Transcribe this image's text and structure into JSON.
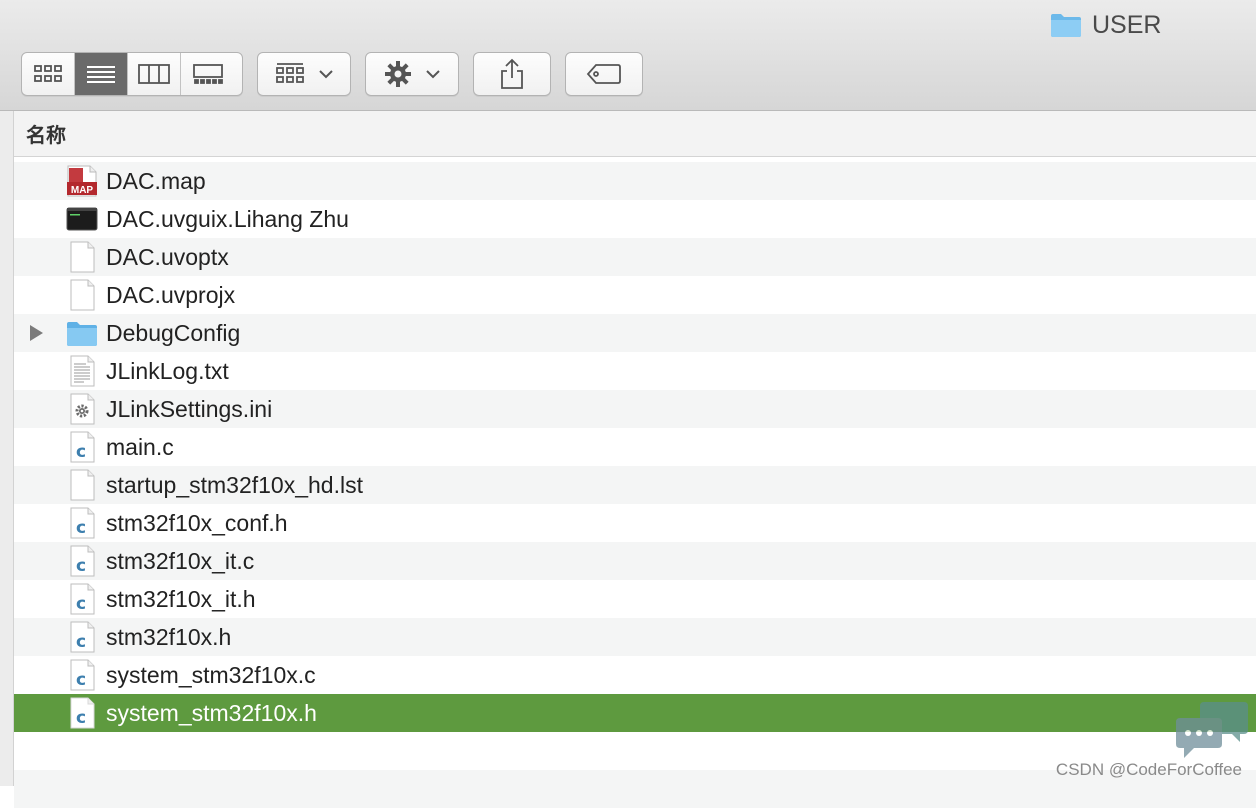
{
  "window": {
    "title": "USER",
    "folder_icon": "folder-icon"
  },
  "toolbar": {
    "view_modes": [
      {
        "name": "icon-view",
        "icon": "grid-icon",
        "active": false
      },
      {
        "name": "list-view",
        "icon": "list-icon",
        "active": true
      },
      {
        "name": "column-view",
        "icon": "columns-icon",
        "active": false
      },
      {
        "name": "gallery-view",
        "icon": "gallery-icon",
        "active": false
      }
    ],
    "group_icon": "group-grid-icon",
    "action_icon": "gear-icon",
    "share_icon": "share-icon",
    "tag_icon": "tag-icon"
  },
  "list": {
    "column_header": "名称",
    "files": [
      {
        "name": "DAC.map",
        "icon": "map-file-icon"
      },
      {
        "name": "DAC.uvguix.Lihang Zhu",
        "icon": "terminal-file-icon"
      },
      {
        "name": "DAC.uvoptx",
        "icon": "blank-file-icon"
      },
      {
        "name": "DAC.uvprojx",
        "icon": "blank-file-icon"
      },
      {
        "name": "DebugConfig",
        "icon": "folder-icon",
        "folder": true
      },
      {
        "name": "JLinkLog.txt",
        "icon": "text-file-icon"
      },
      {
        "name": "JLinkSettings.ini",
        "icon": "settings-file-icon"
      },
      {
        "name": "main.c",
        "icon": "c-file-icon"
      },
      {
        "name": "startup_stm32f10x_hd.lst",
        "icon": "blank-file-icon"
      },
      {
        "name": "stm32f10x_conf.h",
        "icon": "c-file-icon"
      },
      {
        "name": "stm32f10x_it.c",
        "icon": "c-file-icon"
      },
      {
        "name": "stm32f10x_it.h",
        "icon": "c-file-icon"
      },
      {
        "name": "stm32f10x.h",
        "icon": "c-file-icon"
      },
      {
        "name": "system_stm32f10x.c",
        "icon": "c-file-icon"
      },
      {
        "name": "system_stm32f10x.h",
        "icon": "c-file-icon",
        "selected": true
      }
    ]
  },
  "watermark": {
    "text": "CSDN @CodeForCoffee"
  },
  "colors": {
    "selection": "#5e9a3f",
    "folder": "#7cc4ef",
    "c_letter": "#3d7fae",
    "map_red": "#b3282d"
  }
}
